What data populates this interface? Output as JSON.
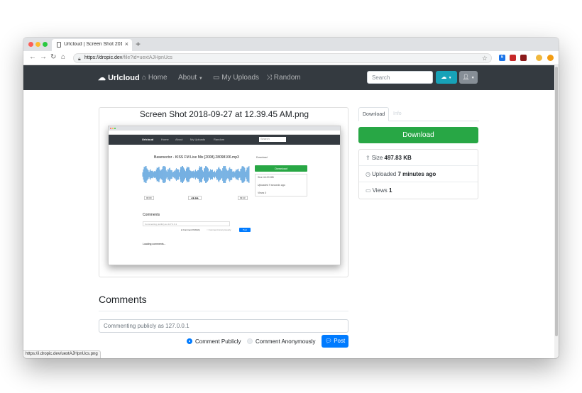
{
  "browser": {
    "tab_title": "Urlcloud | Screen Shot 2018-0",
    "new_tab_glyph": "+",
    "url_prefix": "https://",
    "url_host": "dropic.dev",
    "url_path": "/file?id=uextAJHpnUcs",
    "status_url": "https://i.dropic.dev/uextAJHpnUcs.png",
    "extension_badge": "6"
  },
  "navbar": {
    "brand": "Urlcloud",
    "home": "Home",
    "about": "About",
    "uploads": "My Uploads",
    "random": "Random",
    "search_placeholder": "Search"
  },
  "file": {
    "title": "Screen Shot 2018-09-27 at 12.39.45 AM.png"
  },
  "sidebar": {
    "tab_download": "Download",
    "tab_info": "Info",
    "download_button": "Download",
    "size_label": "Size",
    "size_value": "497.83 KB",
    "uploaded_label": "Uploaded",
    "uploaded_value": "7 minutes ago",
    "views_label": "Views",
    "views_value": "1"
  },
  "comments": {
    "heading": "Comments",
    "input_placeholder": "Commenting publicly as 127.0.0.1",
    "radio_public": "Comment Publicly",
    "radio_anon": "Comment Anonymously",
    "post_button": "Post"
  },
  "preview": {
    "brand": "Urlcloud",
    "home": "Home",
    "about": "About",
    "uploads": "My Uploads",
    "random": "Random",
    "search": "Search",
    "audio_title": "Basenector - KISS FM Live Mix [2008]-28098106.mp3",
    "time_start": "00:00",
    "time_end": "09:43",
    "tab_download": "Download",
    "download_button": "Download",
    "size": "Size 44.00 MB",
    "uploaded": "Uploaded 9 seconds ago",
    "views": "Views 0",
    "comments_heading": "Comments",
    "comment_input": "Commenting publicly as 127.0.0.1",
    "radio_public": "Comment Publicly",
    "radio_anon": "Comment Anonymously",
    "post": "Post",
    "loading": "Loading comments..."
  },
  "colors": {
    "navbar_bg": "#343a40",
    "download_green": "#28a745",
    "post_blue": "#007bff",
    "cloud_teal": "#17a2b8",
    "waveform": "#3b8fd6"
  }
}
